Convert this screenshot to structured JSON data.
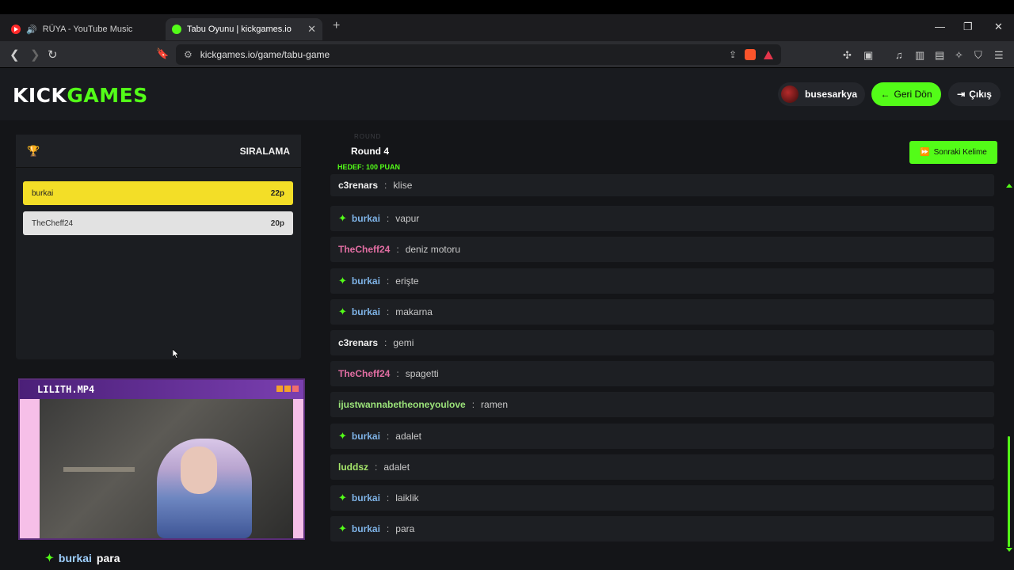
{
  "browser": {
    "tabs": [
      {
        "title": "RÜYA - YouTube Music",
        "icon": "youtube-music-icon"
      },
      {
        "title": "Tabu Oyunu | kickgames.io",
        "icon": "kickgames-icon"
      }
    ],
    "url": "kickgames.io/game/tabu-game"
  },
  "header": {
    "logo_kick": "KICK",
    "logo_games": "GAMES",
    "username": "busesarkya",
    "back_label": "Geri Dön",
    "exit_label": "Çıkış"
  },
  "ranking": {
    "title": "SIRALAMA",
    "rows": [
      {
        "name": "burkai",
        "points": "22p"
      },
      {
        "name": "TheCheff24",
        "points": "20p"
      }
    ]
  },
  "webcam": {
    "title": "LILITH.MP4"
  },
  "overlay_chat": {
    "user": "burkai",
    "message": "para"
  },
  "game": {
    "round_faint": "ROUND",
    "round_label": "Round 4",
    "target": "HEDEF: 100 PUAN",
    "next_word_label": "Sonraki Kelime"
  },
  "chat": [
    {
      "user": "c3renars",
      "message": "klise",
      "icon": false,
      "color": "white"
    },
    {
      "user": "burkai",
      "message": "vapur",
      "icon": true,
      "color": "blue"
    },
    {
      "user": "TheCheff24",
      "message": "deniz motoru",
      "icon": false,
      "color": "pink"
    },
    {
      "user": "burkai",
      "message": "erişte",
      "icon": true,
      "color": "blue"
    },
    {
      "user": "burkai",
      "message": "makarna",
      "icon": true,
      "color": "blue"
    },
    {
      "user": "c3renars",
      "message": "gemi",
      "icon": false,
      "color": "white"
    },
    {
      "user": "TheCheff24",
      "message": "spagetti",
      "icon": false,
      "color": "pink"
    },
    {
      "user": "ijustwannabetheoneyoulove",
      "message": "ramen",
      "icon": false,
      "color": "green"
    },
    {
      "user": "burkai",
      "message": "adalet",
      "icon": true,
      "color": "blue"
    },
    {
      "user": "luddsz",
      "message": "adalet",
      "icon": false,
      "color": "yellowgreen"
    },
    {
      "user": "burkai",
      "message": "laiklik",
      "icon": true,
      "color": "blue"
    },
    {
      "user": "burkai",
      "message": "para",
      "icon": true,
      "color": "blue"
    }
  ],
  "colors": {
    "accent": "#53fc18",
    "rank_first": "#f3de27",
    "rank_second": "#e2e2e2"
  }
}
